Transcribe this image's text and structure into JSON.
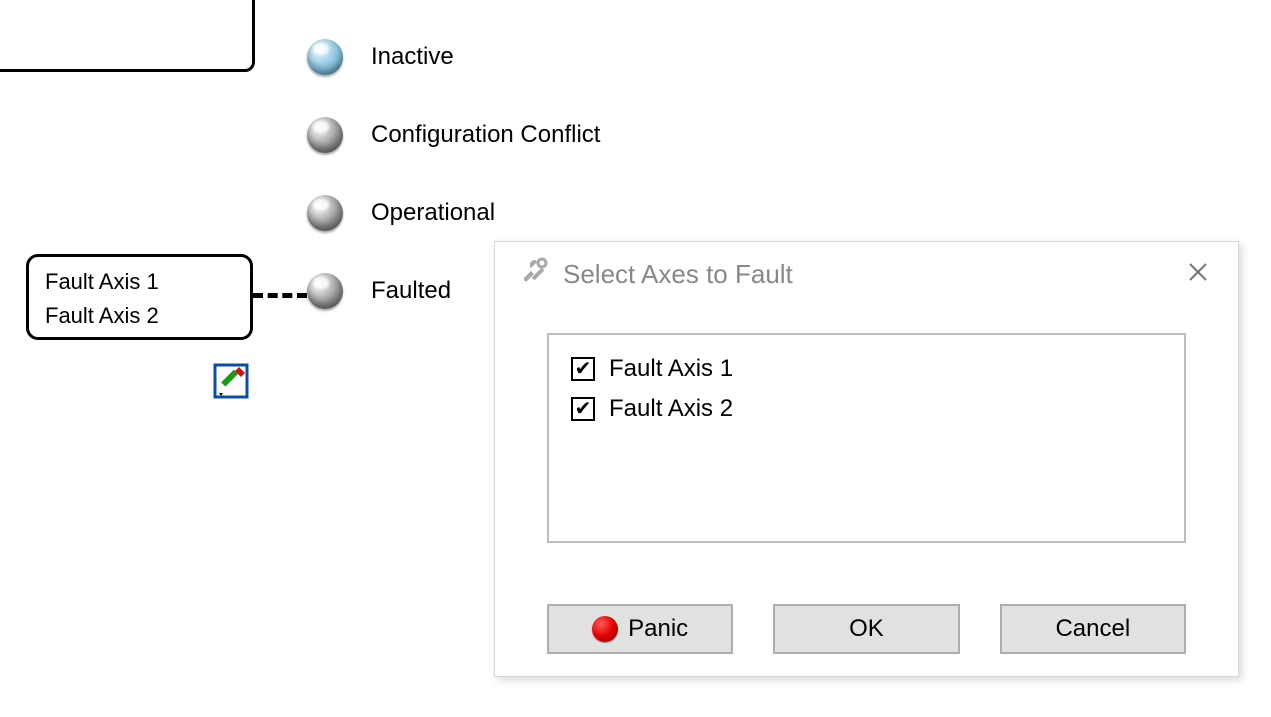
{
  "states": {
    "inactive": {
      "label": "Inactive",
      "orb": "blue"
    },
    "confconflict": {
      "label": "Configuration Conflict",
      "orb": "grey"
    },
    "operational": {
      "label": "Operational",
      "orb": "grey"
    },
    "faulted": {
      "label": "Faulted",
      "orb": "grey"
    }
  },
  "note": {
    "line1": "Fault Axis 1",
    "line2": "Fault Axis 2"
  },
  "icons": {
    "edit": "edit-pencil-icon",
    "tools": "tools-icon",
    "close": "close-icon",
    "panic_dot": "panic-indicator"
  },
  "dialog": {
    "title": "Select Axes to Fault",
    "options": [
      {
        "label": "Fault Axis 1",
        "checked": true
      },
      {
        "label": "Fault Axis 2",
        "checked": true
      }
    ],
    "buttons": {
      "panic": "Panic",
      "ok": "OK",
      "cancel": "Cancel"
    }
  }
}
